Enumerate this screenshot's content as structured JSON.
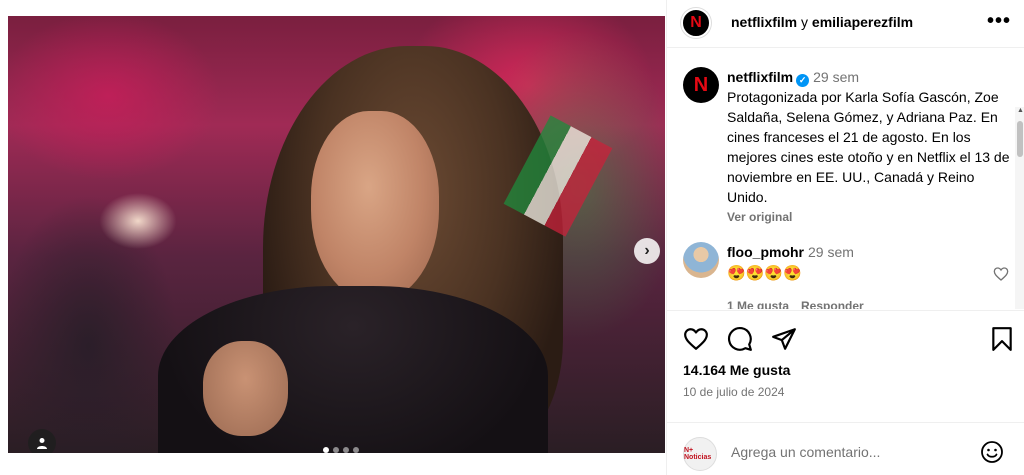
{
  "post": {
    "owners": {
      "first": "netflixfilm",
      "separator": "y",
      "second": "emiliaperezfilm"
    },
    "owner_avatar_letter": "N",
    "more_label": "•••"
  },
  "media": {
    "next_label": "›",
    "carousel_count": 4,
    "carousel_active_index": 0
  },
  "caption": {
    "username": "netflixfilm",
    "verified_mark": "✓",
    "time": "29 sem",
    "text": "Protagonizada por Karla Sofía Gascón, Zoe Saldaña, Selena Gómez, y Adriana Paz. En cines franceses el 21 de agosto. En los mejores cines este otoño y en Netflix el 13 de noviembre en EE. UU., Canadá y Reino Unido.",
    "see_original": "Ver original"
  },
  "comment": {
    "username": "floo_pmohr",
    "time": "29 sem",
    "text": "😍😍😍😍",
    "likes": "1 Me gusta",
    "reply": "Responder"
  },
  "stats": {
    "likes": "14.164 Me gusta",
    "date": "10 de julio de 2024"
  },
  "composer": {
    "avatar_label": "N+ Noticias",
    "placeholder": "Agrega un comentario..."
  },
  "scrollbar": {
    "up": "▲",
    "down": "▼"
  },
  "colors": {
    "accent": "#0095f6",
    "muted": "#737373",
    "netflix_red": "#e50914",
    "divider": "#efefef"
  },
  "icons": [
    "like-icon",
    "comment-icon",
    "share-icon",
    "save-icon",
    "emoji-icon",
    "user-tag-icon",
    "next-icon",
    "more-icon"
  ]
}
